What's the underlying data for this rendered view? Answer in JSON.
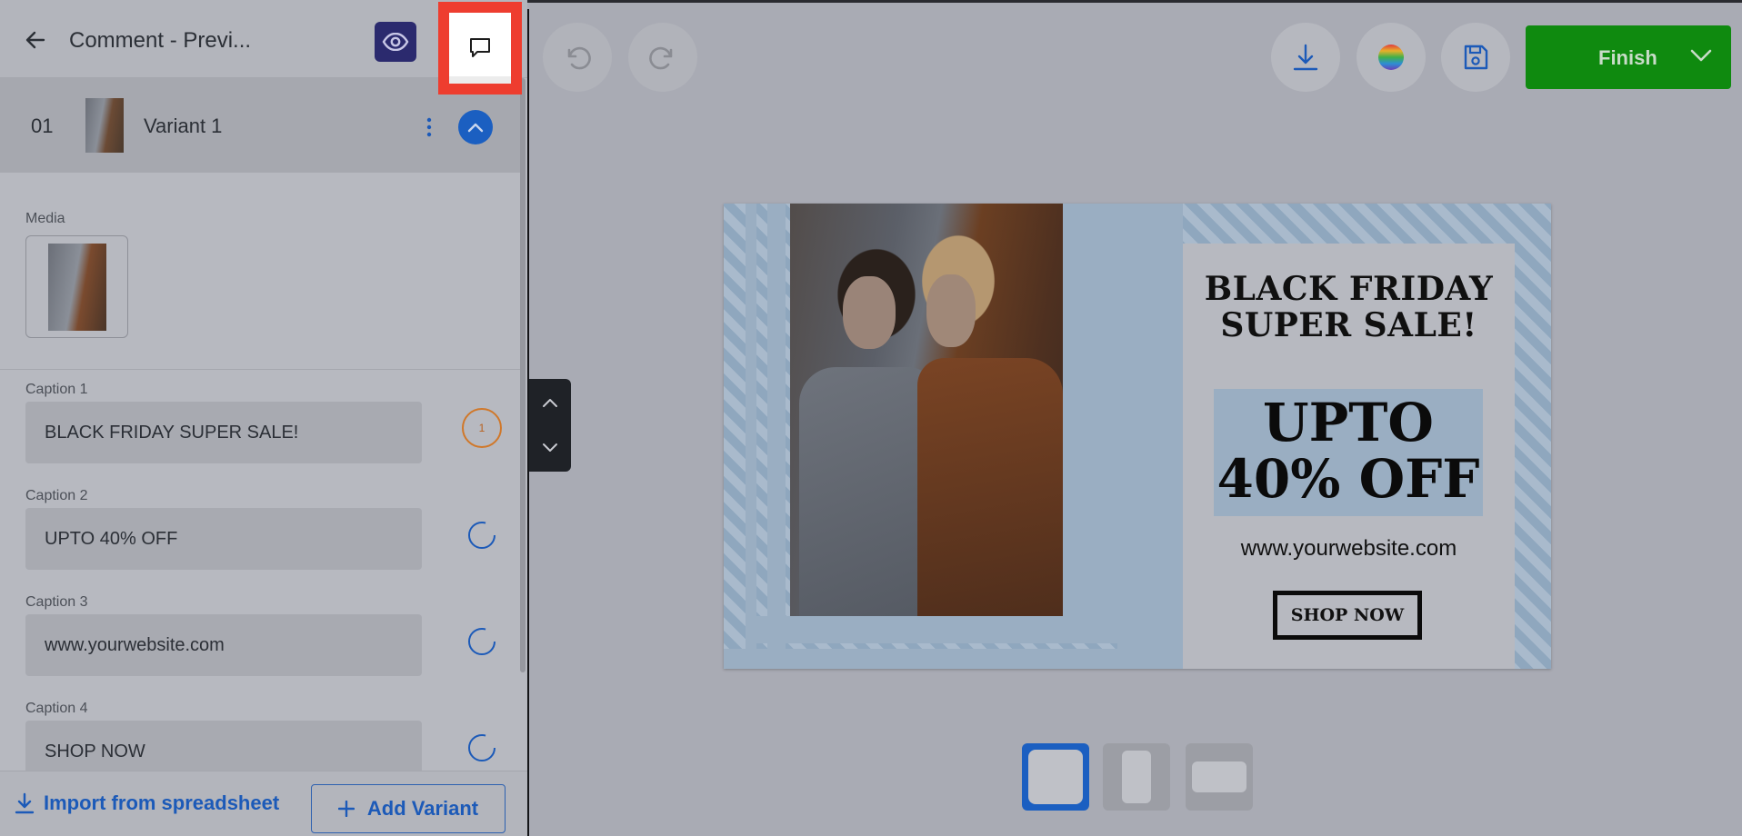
{
  "header": {
    "title": "Comment - Previ..."
  },
  "variant": {
    "number": "01",
    "name": "Variant 1"
  },
  "media": {
    "label": "Media"
  },
  "captions": [
    {
      "label": "Caption 1",
      "value": "BLACK FRIDAY SUPER SALE!",
      "comment_count": "1"
    },
    {
      "label": "Caption 2",
      "value": "UPTO 40% OFF"
    },
    {
      "label": "Caption 3",
      "value": "www.yourwebsite.com"
    },
    {
      "label": "Caption 4",
      "value": "SHOP NOW"
    }
  ],
  "footer": {
    "import_label": "Import from spreadsheet",
    "add_variant_label": "Add Variant"
  },
  "toolbar": {
    "finish_label": "Finish"
  },
  "creative": {
    "headline_line1": "BLACK FRIDAY",
    "headline_line2": "SUPER SALE!",
    "offer_line1": "UPTO",
    "offer_line2": "40% OFF",
    "website": "www.yourwebsite.com",
    "cta": "SHOP NOW"
  },
  "colors": {
    "accent": "#1b5fc1",
    "finish": "#0f8a0f",
    "highlight": "#ee3d2f",
    "comment_badge": "#d0782a"
  }
}
